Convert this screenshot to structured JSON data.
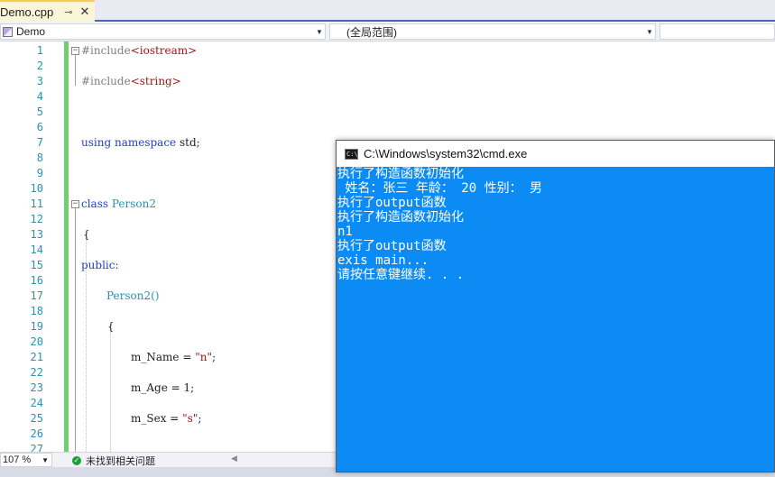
{
  "tab": {
    "title": "Demo.cpp",
    "pin": "⊸",
    "close": "✕"
  },
  "nav": {
    "project": "Demo",
    "scope": "(全局范围)"
  },
  "code": {
    "line_numbers": [
      "1",
      "2",
      "3",
      "4",
      "5",
      "6",
      "7",
      "8",
      "9",
      "10",
      "11",
      "12",
      "13",
      "14",
      "15",
      "16",
      "17",
      "18",
      "19",
      "20",
      "21",
      "22",
      "23",
      "24",
      "25",
      "26",
      "27"
    ],
    "l1_pre": "#include",
    "l1_lib": "<iostream>",
    "l3_pre": "#include",
    "l3_lib": "<string>",
    "l7_using": "using",
    "l7_namespace": "namespace",
    "l7_std": " std;",
    "l11_class": "class",
    "l11_name": "Person2",
    "l13_brace": "{",
    "l15_public": "public:",
    "l17_ctor": "Person2()",
    "l19_brace": "{",
    "l21_field": "m_Name = ",
    "l21_val": "\"n\"",
    "l21_end": ";",
    "l23_stmt": "m_Age = 1;",
    "l25_field": "m_Sex = ",
    "l25_val": "\"s\"",
    "l25_end": ";"
  },
  "status": {
    "zoom": "107 %",
    "issues": "未找到相关问题"
  },
  "console": {
    "title": "C:\\Windows\\system32\\cmd.exe",
    "lines": [
      "执行了构造函数初始化",
      " 姓名：张三 年龄： 20 性别： 男",
      "执行了output函数",
      "执行了构造函数初始化",
      "n1",
      "执行了output函数",
      "exis main...",
      "请按任意键继续. . ."
    ]
  },
  "colors": {
    "console_bg": "#0c8bf5",
    "keyword": "#2140c8",
    "class_name": "#2b91af",
    "string": "#a31515",
    "change_bar": "#6cd16c"
  }
}
